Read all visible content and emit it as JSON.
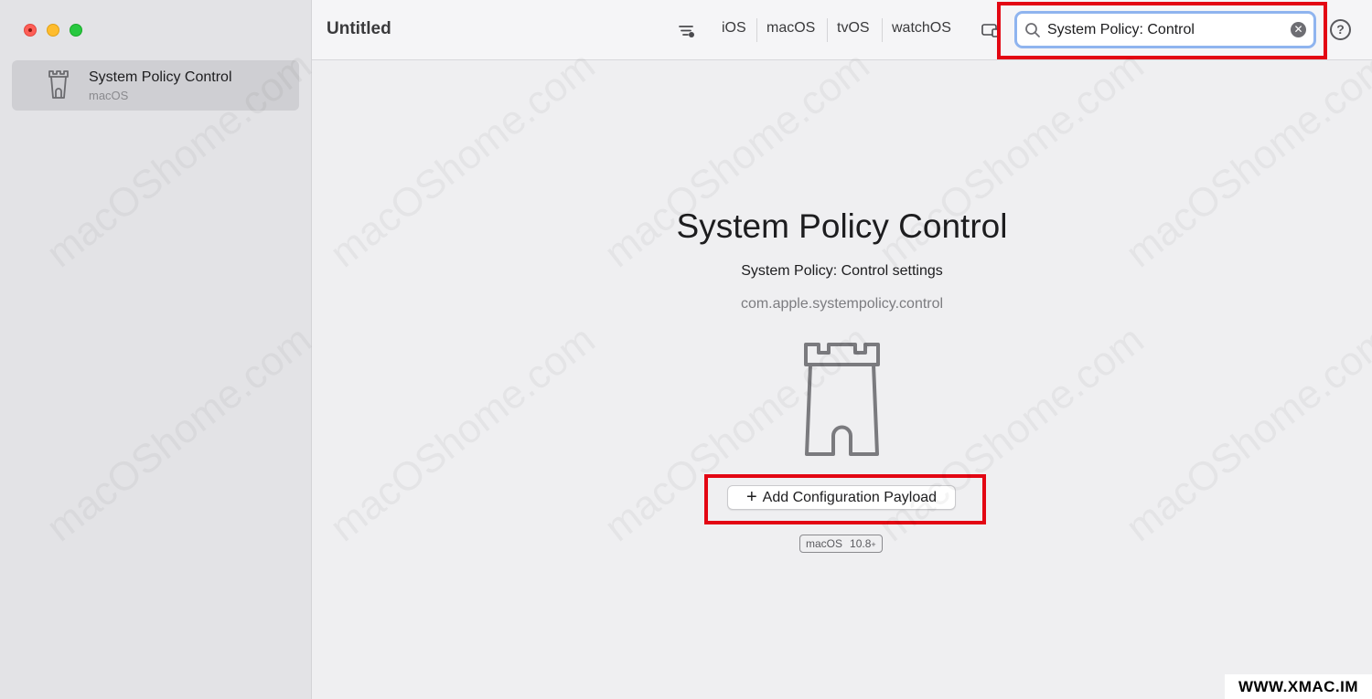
{
  "window": {
    "title": "Untitled"
  },
  "sidebar": {
    "items": [
      {
        "title": "System Policy Control",
        "subtitle": "macOS",
        "icon": "tower-icon"
      }
    ]
  },
  "toolbar": {
    "filter_icon": "filter-icon",
    "platforms": [
      "iOS",
      "macOS",
      "tvOS",
      "watchOS"
    ],
    "device_icon": "device-icon",
    "search": {
      "value": "System Policy: Control",
      "placeholder": "Search"
    },
    "help_label": "?"
  },
  "main": {
    "title": "System Policy Control",
    "description": "System Policy: Control settings",
    "identifier": "com.apple.systempolicy.control",
    "icon": "tower-icon",
    "add_button_label": "Add Configuration Payload",
    "add_button_icon": "+",
    "version_badge": {
      "platform": "macOS",
      "version": "10.8",
      "suffix": "+"
    }
  },
  "watermark": {
    "text": "macOShome.com",
    "corner": "WWW.XMAC.IM"
  },
  "colors": {
    "highlight": "#e30613",
    "search_focus": "#8fb4ef",
    "sidebar_bg": "#e3e3e6",
    "main_bg": "#efeff1"
  }
}
